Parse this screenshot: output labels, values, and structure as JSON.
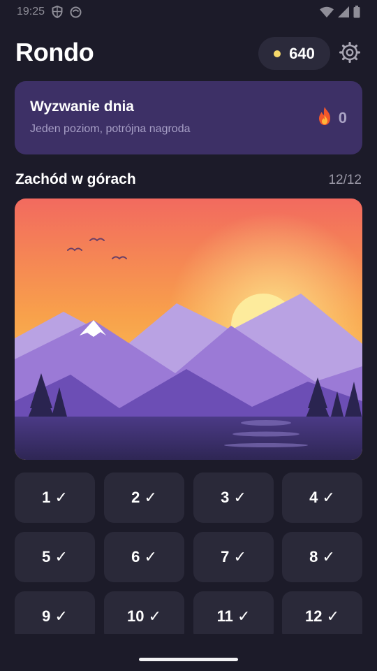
{
  "status_bar": {
    "time": "19:25",
    "icons": [
      "shield-icon",
      "face-icon",
      "wifi-icon",
      "signal-icon",
      "battery-icon"
    ]
  },
  "header": {
    "title": "Rondo",
    "coins": "640",
    "coin_color": "#f6d86a",
    "settings_icon": "gear-icon"
  },
  "challenge": {
    "title": "Wyzwanie dnia",
    "subtitle": "Jeden poziom, potrójna nagroda",
    "streak_icon": "fire-icon",
    "streak_count": "0",
    "background": "#3d3066"
  },
  "level": {
    "title": "Zachód w górach",
    "progress": "12/12"
  },
  "levels": [
    {
      "label": "1 ✓"
    },
    {
      "label": "2 ✓"
    },
    {
      "label": "3 ✓"
    },
    {
      "label": "4 ✓"
    },
    {
      "label": "5 ✓"
    },
    {
      "label": "6 ✓"
    },
    {
      "label": "7 ✓"
    },
    {
      "label": "8 ✓"
    },
    {
      "label": "9 ✓"
    },
    {
      "label": "10 ✓"
    },
    {
      "label": "11 ✓"
    },
    {
      "label": "12 ✓"
    }
  ],
  "colors": {
    "background": "#1c1b29",
    "card": "#2a2939",
    "accent_purple": "#7f5cc4"
  }
}
